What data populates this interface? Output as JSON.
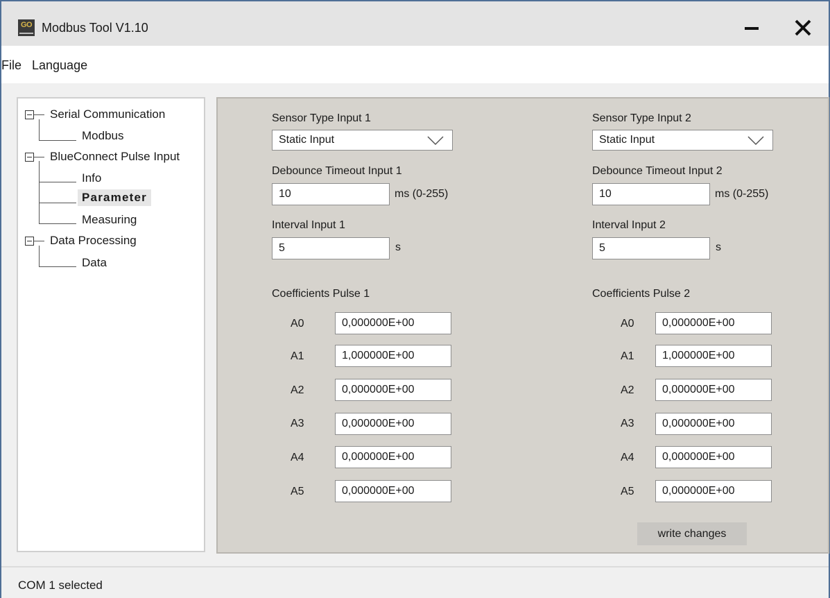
{
  "window": {
    "title": "Modbus Tool V1.10",
    "logo_text": "GO"
  },
  "menu": {
    "items": [
      {
        "label": "File"
      },
      {
        "label": "Language"
      }
    ]
  },
  "tree": {
    "groups": [
      {
        "label": "Serial Communication",
        "expanded": true,
        "children": [
          {
            "label": "Modbus"
          }
        ]
      },
      {
        "label": "BlueConnect Pulse Input",
        "expanded": true,
        "children": [
          {
            "label": "Info"
          },
          {
            "label": "Parameter",
            "selected": true
          },
          {
            "label": "Measuring"
          }
        ]
      },
      {
        "label": "Data Processing",
        "expanded": true,
        "children": [
          {
            "label": "Data"
          }
        ]
      }
    ]
  },
  "inputs": [
    {
      "sensor_type_label": "Sensor Type Input 1",
      "sensor_type_value": "Static Input",
      "debounce_label": "Debounce Timeout Input 1",
      "debounce_value": "10",
      "debounce_unit": "ms (0-255)",
      "interval_label": "Interval Input 1",
      "interval_value": "5",
      "interval_unit": "s",
      "coefficients_label": "Coefficients Pulse 1",
      "coefficients": [
        {
          "name": "A0",
          "value": "0,000000E+00"
        },
        {
          "name": "A1",
          "value": "1,000000E+00"
        },
        {
          "name": "A2",
          "value": "0,000000E+00"
        },
        {
          "name": "A3",
          "value": "0,000000E+00"
        },
        {
          "name": "A4",
          "value": "0,000000E+00"
        },
        {
          "name": "A5",
          "value": "0,000000E+00"
        }
      ]
    },
    {
      "sensor_type_label": "Sensor Type Input 2",
      "sensor_type_value": "Static Input",
      "debounce_label": "Debounce Timeout Input 2",
      "debounce_value": "10",
      "debounce_unit": "ms (0-255)",
      "interval_label": "Interval Input 2",
      "interval_value": "5",
      "interval_unit": "s",
      "coefficients_label": "Coefficients Pulse 2",
      "coefficients": [
        {
          "name": "A0",
          "value": "0,000000E+00"
        },
        {
          "name": "A1",
          "value": "1,000000E+00"
        },
        {
          "name": "A2",
          "value": "0,000000E+00"
        },
        {
          "name": "A3",
          "value": "0,000000E+00"
        },
        {
          "name": "A4",
          "value": "0,000000E+00"
        },
        {
          "name": "A5",
          "value": "0,000000E+00"
        }
      ]
    }
  ],
  "write_button_label": "write changes",
  "status": {
    "text": "COM 1 selected"
  },
  "colors": {
    "panel_bg": "#d6d3cd",
    "window_border": "#4f6f96",
    "accent_logo": "#d8b54a"
  }
}
